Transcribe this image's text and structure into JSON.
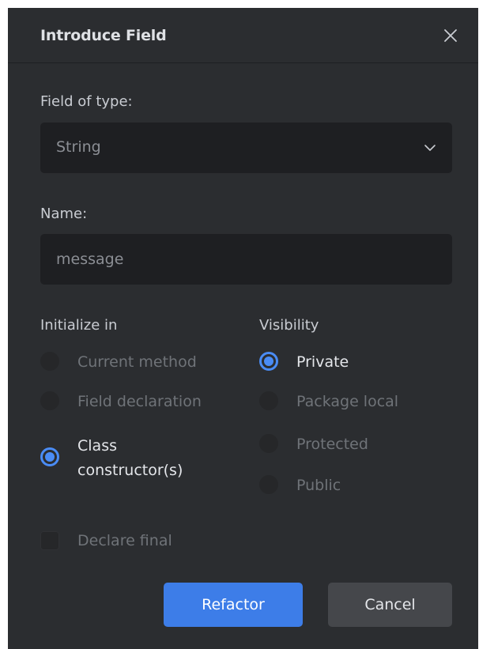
{
  "dialog": {
    "title": "Introduce Field",
    "close_icon": "close-icon"
  },
  "field_type": {
    "label": "Field of type:",
    "value": "String",
    "icon": "chevron-down-icon"
  },
  "name": {
    "label": "Name:",
    "placeholder": "message"
  },
  "initialize_in": {
    "label": "Initialize in",
    "options": [
      {
        "label": "Current method",
        "checked": false
      },
      {
        "label": "Field declaration",
        "checked": false
      },
      {
        "label_line1": "Class",
        "label_line2": "constructor(s)",
        "checked": true
      }
    ]
  },
  "visibility": {
    "label": "Visibility",
    "options": [
      {
        "label": "Private",
        "checked": true
      },
      {
        "label": "Package local",
        "checked": false
      },
      {
        "label": "Protected",
        "checked": false
      },
      {
        "label": "Public",
        "checked": false
      }
    ]
  },
  "declare_final": {
    "label": "Declare final",
    "checked": false
  },
  "buttons": {
    "refactor": "Refactor",
    "cancel": "Cancel"
  },
  "colors": {
    "background": "#2b2d30",
    "input_background": "#1e1f22",
    "accent": "#3d7de8",
    "secondary_button": "#45474b"
  }
}
